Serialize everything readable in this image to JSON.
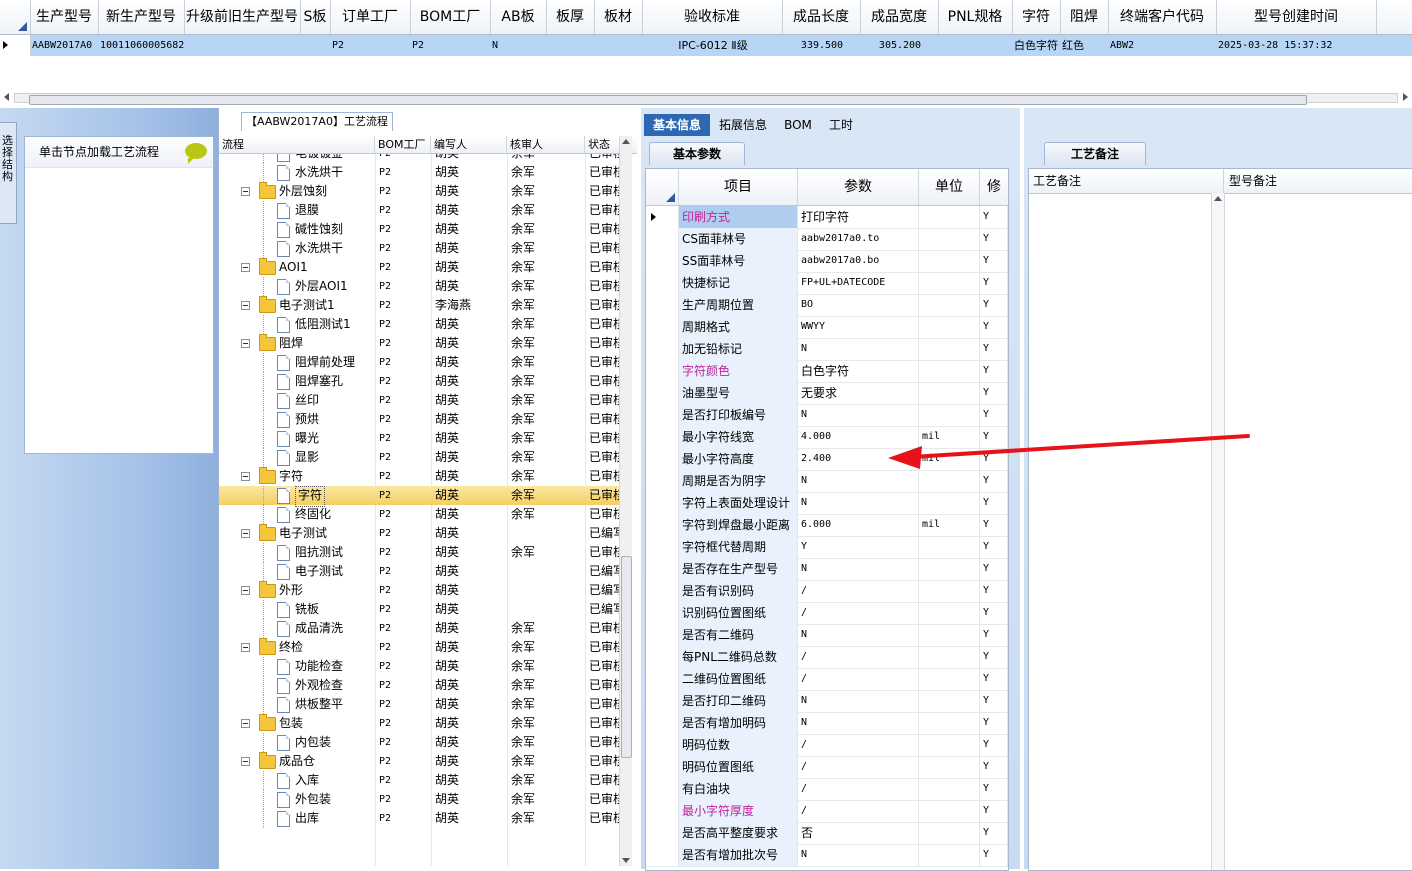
{
  "top_grid": {
    "headers": [
      "生产型号",
      "新生产型号",
      "升级前旧生产型号",
      "S板",
      "订单工厂",
      "BOM工厂",
      "AB板",
      "板厚",
      "板材",
      "验收标准",
      "成品长度",
      "成品宽度",
      "PNL规格",
      "字符",
      "阻焊",
      "终端客户代码",
      "型号创建时间"
    ],
    "row": [
      "AABW2017A0",
      "10011060005682",
      "",
      "",
      "P2",
      "P2",
      "N",
      "",
      "",
      "IPC-6012 Ⅱ级",
      "339.500",
      "305.200",
      "",
      "白色字符",
      "红色",
      "ABW2",
      "2025-03-28 15:37:32"
    ]
  },
  "left_panel": {
    "vertical_tab": "选择结构",
    "hint": "单击节点加载工艺流程"
  },
  "tree": {
    "tab_title": "【AABW2017A0】工艺流程",
    "headers": [
      "流程",
      "BOM工厂",
      "编写人",
      "核审人",
      "状态"
    ],
    "rows": [
      {
        "name": "电镀镀金",
        "level": 2,
        "bom": "P2",
        "writer": "胡英",
        "reviewer": "余军",
        "status": "已审核"
      },
      {
        "name": "水洗烘干",
        "level": 2,
        "bom": "P2",
        "writer": "胡英",
        "reviewer": "余军",
        "status": "已审核"
      },
      {
        "name": "外层蚀刻",
        "level": 1,
        "bom": "P2",
        "writer": "胡英",
        "reviewer": "余军",
        "status": "已审核"
      },
      {
        "name": "退膜",
        "level": 2,
        "bom": "P2",
        "writer": "胡英",
        "reviewer": "余军",
        "status": "已审核"
      },
      {
        "name": "碱性蚀刻",
        "level": 2,
        "bom": "P2",
        "writer": "胡英",
        "reviewer": "余军",
        "status": "已审核"
      },
      {
        "name": "水洗烘干",
        "level": 2,
        "bom": "P2",
        "writer": "胡英",
        "reviewer": "余军",
        "status": "已审核"
      },
      {
        "name": "AOI1",
        "level": 1,
        "bom": "P2",
        "writer": "胡英",
        "reviewer": "余军",
        "status": "已审核"
      },
      {
        "name": "外层AOI1",
        "level": 2,
        "bom": "P2",
        "writer": "胡英",
        "reviewer": "余军",
        "status": "已审核"
      },
      {
        "name": "电子测试1",
        "level": 1,
        "bom": "P2",
        "writer": "李海燕",
        "reviewer": "余军",
        "status": "已审核"
      },
      {
        "name": "低阻测试1",
        "level": 2,
        "bom": "P2",
        "writer": "胡英",
        "reviewer": "余军",
        "status": "已审核"
      },
      {
        "name": "阻焊",
        "level": 1,
        "bom": "P2",
        "writer": "胡英",
        "reviewer": "余军",
        "status": "已审核"
      },
      {
        "name": "阻焊前处理",
        "level": 2,
        "bom": "P2",
        "writer": "胡英",
        "reviewer": "余军",
        "status": "已审核"
      },
      {
        "name": "阻焊塞孔",
        "level": 2,
        "bom": "P2",
        "writer": "胡英",
        "reviewer": "余军",
        "status": "已审核"
      },
      {
        "name": "丝印",
        "level": 2,
        "bom": "P2",
        "writer": "胡英",
        "reviewer": "余军",
        "status": "已审核"
      },
      {
        "name": "预烘",
        "level": 2,
        "bom": "P2",
        "writer": "胡英",
        "reviewer": "余军",
        "status": "已审核"
      },
      {
        "name": "曝光",
        "level": 2,
        "bom": "P2",
        "writer": "胡英",
        "reviewer": "余军",
        "status": "已审核"
      },
      {
        "name": "显影",
        "level": 2,
        "bom": "P2",
        "writer": "胡英",
        "reviewer": "余军",
        "status": "已审核"
      },
      {
        "name": "字符",
        "level": 1,
        "bom": "P2",
        "writer": "胡英",
        "reviewer": "余军",
        "status": "已审核"
      },
      {
        "name": "字符",
        "level": 2,
        "bom": "P2",
        "writer": "胡英",
        "reviewer": "余军",
        "status": "已审核",
        "selected": true
      },
      {
        "name": "终固化",
        "level": 2,
        "bom": "P2",
        "writer": "胡英",
        "reviewer": "余军",
        "status": "已审核"
      },
      {
        "name": "电子测试",
        "level": 1,
        "bom": "P2",
        "writer": "胡英",
        "reviewer": "",
        "status": "已编写"
      },
      {
        "name": "阻抗测试",
        "level": 2,
        "bom": "P2",
        "writer": "胡英",
        "reviewer": "余军",
        "status": "已审核"
      },
      {
        "name": "电子测试",
        "level": 2,
        "bom": "P2",
        "writer": "胡英",
        "reviewer": "",
        "status": "已编写"
      },
      {
        "name": "外形",
        "level": 1,
        "bom": "P2",
        "writer": "胡英",
        "reviewer": "",
        "status": "已编写"
      },
      {
        "name": "铣板",
        "level": 2,
        "bom": "P2",
        "writer": "胡英",
        "reviewer": "",
        "status": "已编写"
      },
      {
        "name": "成品清洗",
        "level": 2,
        "bom": "P2",
        "writer": "胡英",
        "reviewer": "余军",
        "status": "已审核"
      },
      {
        "name": "终检",
        "level": 1,
        "bom": "P2",
        "writer": "胡英",
        "reviewer": "余军",
        "status": "已审核"
      },
      {
        "name": "功能检查",
        "level": 2,
        "bom": "P2",
        "writer": "胡英",
        "reviewer": "余军",
        "status": "已审核"
      },
      {
        "name": "外观检查",
        "level": 2,
        "bom": "P2",
        "writer": "胡英",
        "reviewer": "余军",
        "status": "已审核"
      },
      {
        "name": "烘板整平",
        "level": 2,
        "bom": "P2",
        "writer": "胡英",
        "reviewer": "余军",
        "status": "已审核"
      },
      {
        "name": "包装",
        "level": 1,
        "bom": "P2",
        "writer": "胡英",
        "reviewer": "余军",
        "status": "已审核"
      },
      {
        "name": "内包装",
        "level": 2,
        "bom": "P2",
        "writer": "胡英",
        "reviewer": "余军",
        "status": "已审核"
      },
      {
        "name": "成品仓",
        "level": 1,
        "bom": "P2",
        "writer": "胡英",
        "reviewer": "余军",
        "status": "已审核"
      },
      {
        "name": "入库",
        "level": 2,
        "bom": "P2",
        "writer": "胡英",
        "reviewer": "余军",
        "status": "已审核"
      },
      {
        "name": "外包装",
        "level": 2,
        "bom": "P2",
        "writer": "胡英",
        "reviewer": "余军",
        "status": "已审核"
      },
      {
        "name": "出库",
        "level": 2,
        "bom": "P2",
        "writer": "胡英",
        "reviewer": "余军",
        "status": "已审核"
      }
    ]
  },
  "center": {
    "tabs": [
      "基本信息",
      "拓展信息",
      "BOM",
      "工时"
    ],
    "active_tab": "基本信息",
    "subtab": "基本参数",
    "headers": [
      "项目",
      "参数",
      "单位",
      "修"
    ],
    "rows": [
      {
        "item": "印刷方式",
        "param": "打印字符",
        "unit": "",
        "mod": "Y",
        "highlight": true
      },
      {
        "item": "CS面菲林号",
        "param": "aabw2017a0.to",
        "unit": "",
        "mod": "Y"
      },
      {
        "item": "SS面菲林号",
        "param": "aabw2017a0.bo",
        "unit": "",
        "mod": "Y"
      },
      {
        "item": "快捷标记",
        "param": "FP+UL+DATECODE",
        "unit": "",
        "mod": "Y"
      },
      {
        "item": "生产周期位置",
        "param": "BO",
        "unit": "",
        "mod": "Y"
      },
      {
        "item": "周期格式",
        "param": "WWYY",
        "unit": "",
        "mod": "Y"
      },
      {
        "item": "加无铅标记",
        "param": "N",
        "unit": "",
        "mod": "Y"
      },
      {
        "item": "字符颜色",
        "param": "白色字符",
        "unit": "",
        "mod": "Y",
        "highlight": true
      },
      {
        "item": "油墨型号",
        "param": "无要求",
        "unit": "",
        "mod": "Y"
      },
      {
        "item": "是否打印板编号",
        "param": "N",
        "unit": "",
        "mod": "Y"
      },
      {
        "item": "最小字符线宽",
        "param": "4.000",
        "unit": "mil",
        "mod": "Y"
      },
      {
        "item": "最小字符高度",
        "param": "2.400",
        "unit": "mil",
        "mod": "Y"
      },
      {
        "item": "周期是否为阴字",
        "param": "N",
        "unit": "",
        "mod": "Y"
      },
      {
        "item": "字符上表面处理设计",
        "param": "N",
        "unit": "",
        "mod": "Y"
      },
      {
        "item": "字符到焊盘最小距离",
        "param": "6.000",
        "unit": "mil",
        "mod": "Y"
      },
      {
        "item": "字符框代替周期",
        "param": "Y",
        "unit": "",
        "mod": "Y"
      },
      {
        "item": "是否存在生产型号",
        "param": "N",
        "unit": "",
        "mod": "Y"
      },
      {
        "item": "是否有识别码",
        "param": "/",
        "unit": "",
        "mod": "Y"
      },
      {
        "item": "识别码位置图纸",
        "param": "/",
        "unit": "",
        "mod": "Y"
      },
      {
        "item": "是否有二维码",
        "param": "N",
        "unit": "",
        "mod": "Y"
      },
      {
        "item": "每PNL二维码总数",
        "param": "/",
        "unit": "",
        "mod": "Y"
      },
      {
        "item": "二维码位置图纸",
        "param": "/",
        "unit": "",
        "mod": "Y"
      },
      {
        "item": "是否打印二维码",
        "param": "N",
        "unit": "",
        "mod": "Y"
      },
      {
        "item": "是否有增加明码",
        "param": "N",
        "unit": "",
        "mod": "Y"
      },
      {
        "item": "明码位数",
        "param": "/",
        "unit": "",
        "mod": "Y"
      },
      {
        "item": "明码位置图纸",
        "param": "/",
        "unit": "",
        "mod": "Y"
      },
      {
        "item": "有白油块",
        "param": "/",
        "unit": "",
        "mod": "Y"
      },
      {
        "item": "最小字符厚度",
        "param": "/",
        "unit": "",
        "mod": "Y",
        "highlight": true
      },
      {
        "item": "是否高平整度要求",
        "param": "否",
        "unit": "",
        "mod": "Y"
      },
      {
        "item": "是否有增加批次号",
        "param": "N",
        "unit": "",
        "mod": "Y"
      }
    ]
  },
  "right": {
    "tab": "工艺备注",
    "headers": [
      "工艺备注",
      "型号备注"
    ]
  },
  "colors": {
    "accent_tab": "#2e68b3",
    "selected_row": "#f4cf62",
    "highlight_text": "#c0249b",
    "annotation_arrow": "#e8131a"
  }
}
